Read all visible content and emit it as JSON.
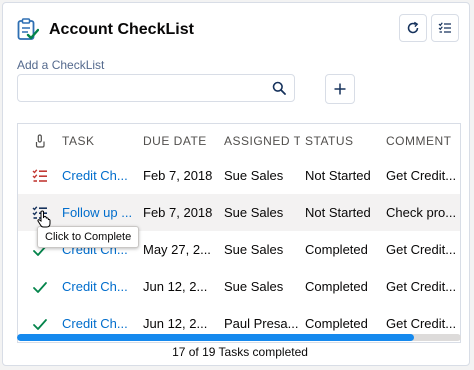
{
  "header": {
    "title": "Account CheckList"
  },
  "add": {
    "label": "Add a CheckList",
    "value": "",
    "placeholder": ""
  },
  "table": {
    "columns": [
      "TASK",
      "DUE DATE",
      "ASSIGNED TO",
      "STATUS",
      "COMMENT"
    ],
    "rows": [
      {
        "status_icon": "incomplete-list-icon",
        "task": "Credit Ch...",
        "due": "Feb 7, 2018",
        "assigned": "Sue Sales",
        "status": "Not Started",
        "comment": "Get Credit..."
      },
      {
        "status_icon": "incomplete-list-icon",
        "task": "Follow up ...",
        "due": "Feb 7, 2018",
        "assigned": "Sue Sales",
        "status": "Not Started",
        "comment": "Check pro..."
      },
      {
        "status_icon": "check-icon",
        "task": "Credit Ch...",
        "due": "May 27, 2...",
        "assigned": "Sue Sales",
        "status": "Completed",
        "comment": "Get Credit..."
      },
      {
        "status_icon": "check-icon",
        "task": "Credit Ch...",
        "due": "Jun 12, 2...",
        "assigned": "Sue Sales",
        "status": "Completed",
        "comment": "Get Credit..."
      },
      {
        "status_icon": "check-icon",
        "task": "Credit Ch...",
        "due": "Jun 12, 2...",
        "assigned": "Paul Presa...",
        "status": "Completed",
        "comment": "Get Credit..."
      }
    ]
  },
  "tooltip": "Click to Complete",
  "progress": {
    "text": "17 of 19 Tasks completed",
    "fraction": 0.895
  },
  "colors": {
    "accent": "#1589ee",
    "link": "#006dcc",
    "complete": "#04844b",
    "incomplete": "#c23934"
  }
}
